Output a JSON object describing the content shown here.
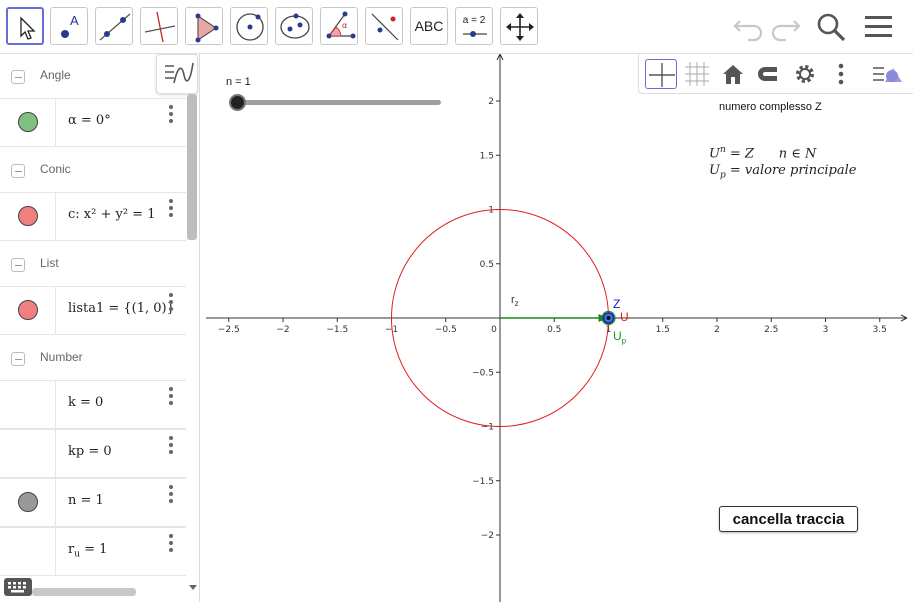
{
  "toolbar": {
    "tools": [
      {
        "name": "move-tool",
        "label": ""
      },
      {
        "name": "point-tool",
        "label": "A"
      },
      {
        "name": "line-tool",
        "label": ""
      },
      {
        "name": "perpendicular-tool",
        "label": ""
      },
      {
        "name": "polygon-tool",
        "label": ""
      },
      {
        "name": "circle-center-tool",
        "label": ""
      },
      {
        "name": "conic-tool",
        "label": ""
      },
      {
        "name": "angle-tool",
        "label": "α"
      },
      {
        "name": "reflect-tool",
        "label": ""
      },
      {
        "name": "text-tool",
        "label": "ABC"
      },
      {
        "name": "slider-tool",
        "label": "a = 2"
      },
      {
        "name": "move-graphics-tool",
        "label": ""
      }
    ]
  },
  "algebra": {
    "groups": [
      {
        "header": "Angle",
        "items": [
          {
            "expr": "α = 0°",
            "color": "#7fbf7f"
          }
        ]
      },
      {
        "header": "Conic",
        "items": [
          {
            "expr": "c: x² + y² = 1",
            "color": "#f08080"
          }
        ]
      },
      {
        "header": "List",
        "items": [
          {
            "expr": "lista1 = {(1, 0)}",
            "color": "#f08080"
          }
        ]
      },
      {
        "header": "Number",
        "items": [
          {
            "expr": "k = 0",
            "color": ""
          },
          {
            "expr": "kp = 0",
            "color": ""
          },
          {
            "expr": "n = 1",
            "color": "#999999"
          },
          {
            "expr_main": "r",
            "expr_sub": "u",
            "expr_rest": " = 1",
            "color": ""
          }
        ]
      }
    ]
  },
  "graphics": {
    "slider_label": "n = 1",
    "text_numero": "numero complesso Z",
    "formula1_a": "U",
    "formula1_sup": "n",
    "formula1_b": " = Z      n ∈ N",
    "formula2_a": "U",
    "formula2_sub": "p",
    "formula2_b": " = valore principale",
    "button_label": "cancella traccia",
    "labels": {
      "rz_main": "r",
      "rz_sub": "z",
      "Z": "Z",
      "U": "U",
      "Up_main": "U",
      "Up_sub": "p"
    },
    "x_ticks": [
      "−2.5",
      "−2",
      "−1.5",
      "−1",
      "−0.5",
      "0",
      "0.5",
      "1",
      "1.5",
      "2",
      "2.5",
      "3",
      "3.5"
    ],
    "y_ticks": [
      "2",
      "1.5",
      "1",
      "0.5",
      "−0.5",
      "−1",
      "−1.5",
      "−2"
    ],
    "colors": {
      "circle": "#e02020",
      "vector": "#1a8a1a",
      "point_z": "#1515c0",
      "label_u": "#e02020",
      "label_up": "#1a9a1a"
    }
  }
}
